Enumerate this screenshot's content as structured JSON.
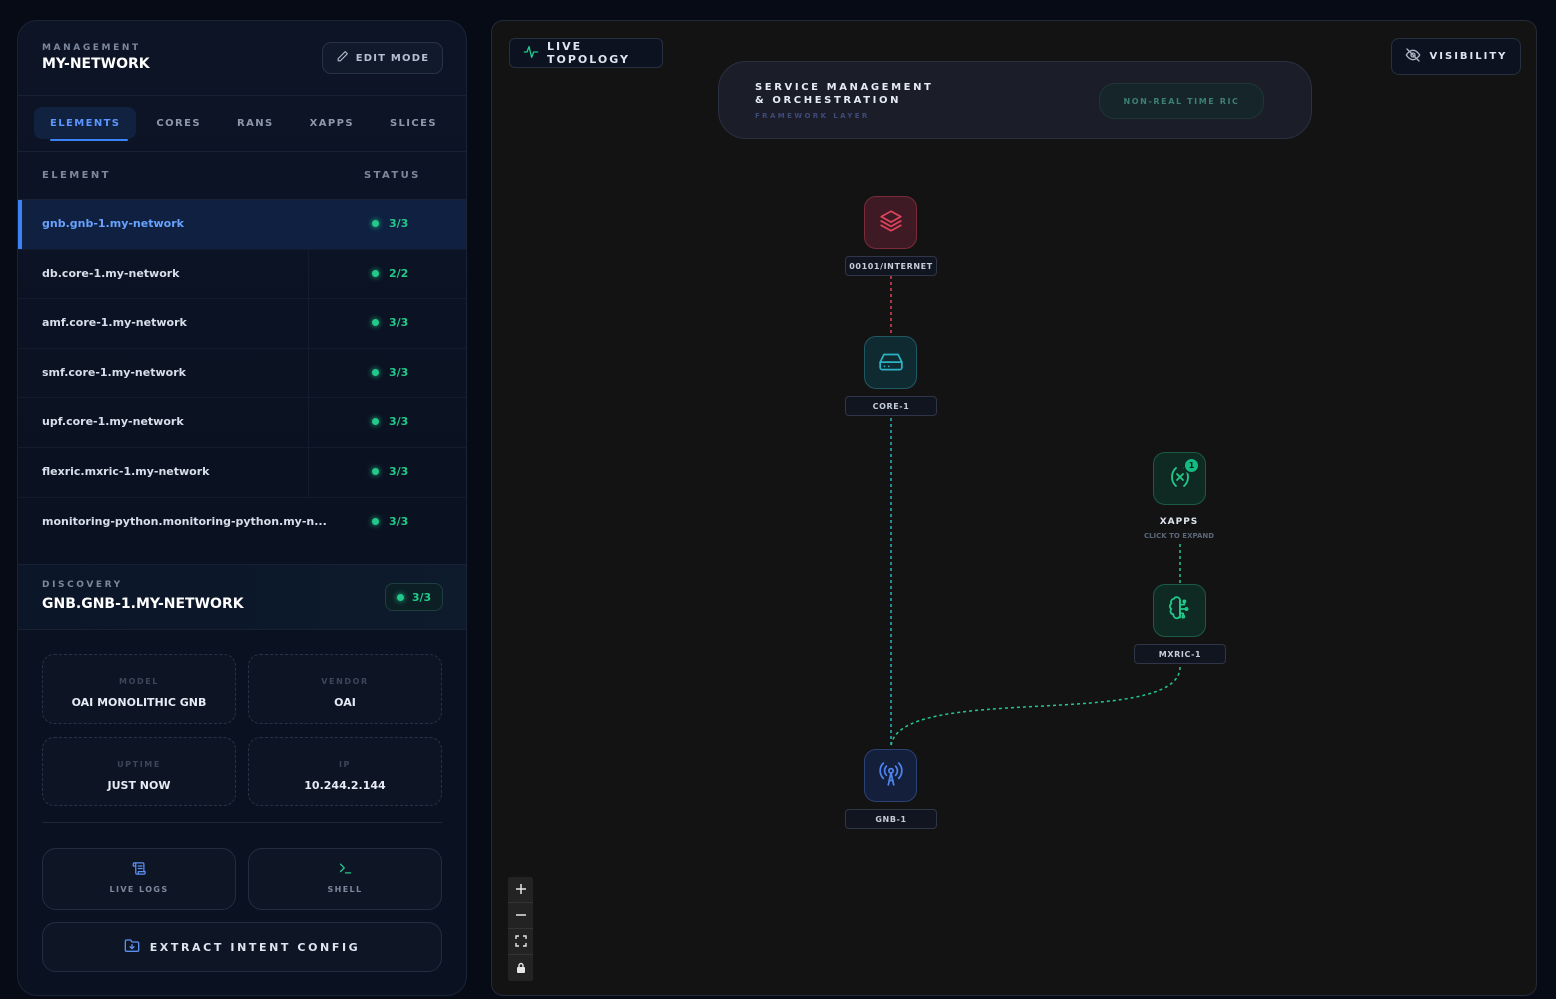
{
  "panel": {
    "eyebrow": "MANAGEMENT",
    "title": "MY-NETWORK",
    "edit_label": "EDIT MODE",
    "tabs": [
      {
        "label": "ELEMENTS",
        "active": true
      },
      {
        "label": "CORES"
      },
      {
        "label": "RANS"
      },
      {
        "label": "XAPPS"
      },
      {
        "label": "SLICES"
      }
    ],
    "columns": {
      "element": "ELEMENT",
      "status": "STATUS"
    },
    "rows": [
      {
        "name": "gnb.gnb-1.my-network",
        "status": "3/3",
        "selected": true
      },
      {
        "name": "db.core-1.my-network",
        "status": "2/2"
      },
      {
        "name": "amf.core-1.my-network",
        "status": "3/3"
      },
      {
        "name": "smf.core-1.my-network",
        "status": "3/3"
      },
      {
        "name": "upf.core-1.my-network",
        "status": "3/3"
      },
      {
        "name": "flexric.mxric-1.my-network",
        "status": "3/3"
      },
      {
        "name": "monitoring-python.monitoring-python.my-n...",
        "status": "3/3"
      }
    ],
    "status_color": "#22c98a"
  },
  "discovery": {
    "eyebrow": "DISCOVERY",
    "title": "GNB.GNB-1.MY-NETWORK",
    "badge": "3/3",
    "cards": {
      "model": {
        "label": "MODEL",
        "value": "OAI MONOLITHIC GNB"
      },
      "vendor": {
        "label": "VENDOR",
        "value": "OAI"
      },
      "uptime": {
        "label": "UPTIME",
        "value": "JUST NOW"
      },
      "ip": {
        "label": "IP",
        "value": "10.244.2.144"
      }
    },
    "actions": {
      "logs": "LIVE LOGS",
      "shell": "SHELL",
      "extract": "EXTRACT INTENT CONFIG"
    }
  },
  "canvas": {
    "live_label": "LIVE TOPOLOGY",
    "visibility_label": "VISIBILITY",
    "smo": {
      "title_line1": "SERVICE MANAGEMENT",
      "title_line2": "& ORCHESTRATION",
      "subtitle": "FRAMEWORK LAYER",
      "ric_label": "NON-REAL TIME RIC"
    },
    "nodes": {
      "internet": "00101/INTERNET",
      "core": "CORE-1",
      "xapps": "XAPPS",
      "xapps_hint": "CLICK TO EXPAND",
      "xapps_count": "1",
      "mxric": "MXRIC-1",
      "gnb": "GNB-1"
    }
  },
  "colors": {
    "accent": "#3b82f6",
    "ok": "#22c98a",
    "internet": "#e0435b",
    "core": "#2bb3c4"
  }
}
